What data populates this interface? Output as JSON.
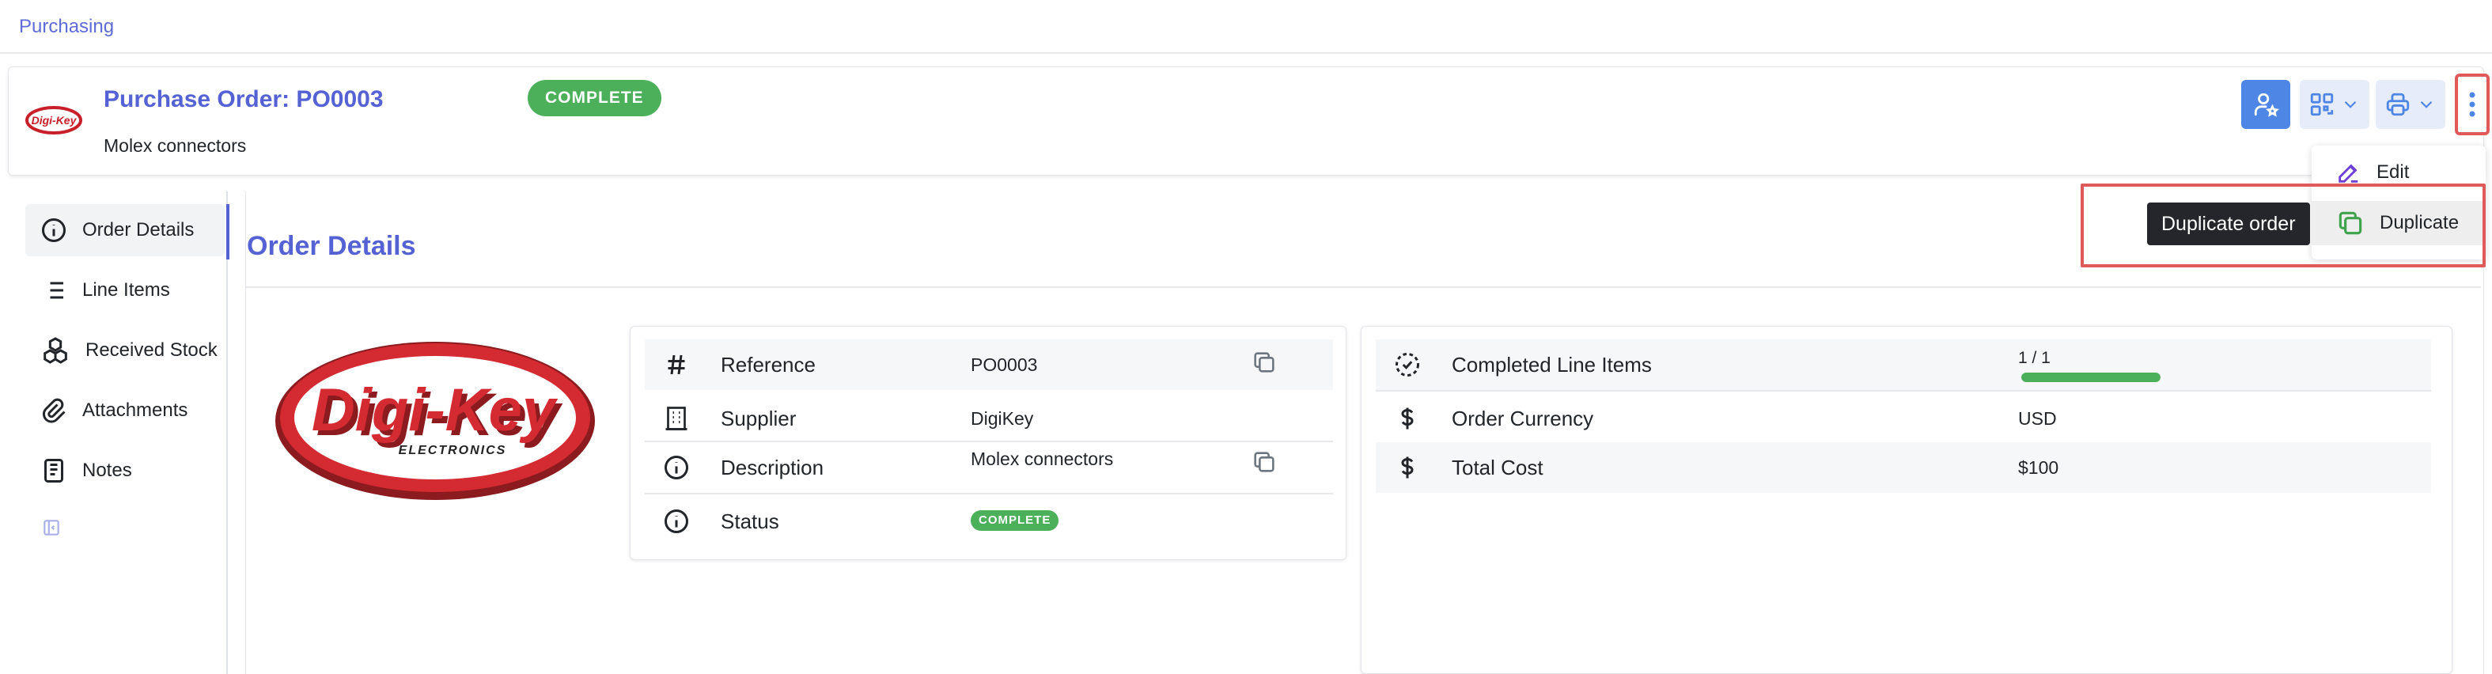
{
  "breadcrumb": "Purchasing",
  "header": {
    "title": "Purchase Order: PO0003",
    "description": "Molex connectors",
    "status_badge": "COMPLETE"
  },
  "actions_menu": {
    "edit_label": "Edit",
    "duplicate_label": "Duplicate",
    "tooltip": "Duplicate order"
  },
  "sidebar": {
    "items": [
      {
        "label": "Order Details",
        "icon": "info-icon",
        "active": true
      },
      {
        "label": "Line Items",
        "icon": "list-icon"
      },
      {
        "label": "Received Stock",
        "icon": "boxes-icon"
      },
      {
        "label": "Attachments",
        "icon": "paperclip-icon"
      },
      {
        "label": "Notes",
        "icon": "notes-icon"
      }
    ]
  },
  "main": {
    "title": "Order Details",
    "company_logo_text": "Digi-Key",
    "company_logo_subtext": "ELECTRONICS",
    "details": {
      "reference_label": "Reference",
      "reference_value": "PO0003",
      "supplier_label": "Supplier",
      "supplier_value": "DigiKey",
      "description_label": "Description",
      "description_value": "Molex connectors",
      "status_label": "Status",
      "status_value": "COMPLETE"
    },
    "summary": {
      "completed_label": "Completed Line Items",
      "completed_value": "1 / 1",
      "completed_fraction": 1.0,
      "currency_label": "Order Currency",
      "currency_value": "USD",
      "total_label": "Total Cost",
      "total_value": "$100"
    }
  },
  "colors": {
    "accent": "#5562d4",
    "success": "#4cb05a",
    "highlight": "#e05a5a",
    "brand_red": "#c8202a"
  }
}
